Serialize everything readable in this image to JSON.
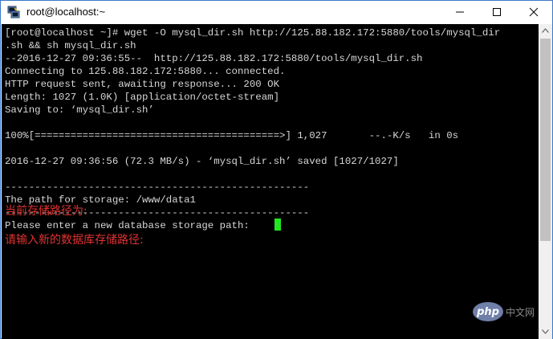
{
  "window": {
    "title": "root@localhost:~",
    "icon": "putty-terminal-icon",
    "controls": [
      "minimize-icon",
      "maximize-icon",
      "close-icon"
    ]
  },
  "terminal": {
    "lines": [
      "[root@localhost ~]# wget -O mysql_dir.sh http://125.88.182.172:5880/tools/mysql_dir",
      ".sh && sh mysql_dir.sh",
      "--2016-12-27 09:36:55--  http://125.88.182.172:5880/tools/mysql_dir.sh",
      "Connecting to 125.88.182.172:5880... connected.",
      "HTTP request sent, awaiting response... 200 OK",
      "Length: 1027 (1.0K) [application/octet-stream]",
      "Saving to: ‘mysql_dir.sh’",
      "",
      "100%[=========================================>] 1,027       --.-K/s   in 0s",
      "",
      "2016-12-27 09:36:56 (72.3 MB/s) - ‘mysql_dir.sh’ saved [1027/1027]",
      "",
      "---------------------------------------------------",
      "The path for storage: /www/data1",
      "---------------------------------------------------",
      "Please enter a new database storage path: "
    ],
    "overlay_cn": [
      "当前存储路径为:",
      "请输入新的数据库存储路径:"
    ],
    "colors": {
      "background": "#000000",
      "text": "#d7d7d7",
      "cursor": "#22e622",
      "annotation": "#e23232"
    }
  },
  "watermark": {
    "logo": "php",
    "text": "中文网"
  }
}
